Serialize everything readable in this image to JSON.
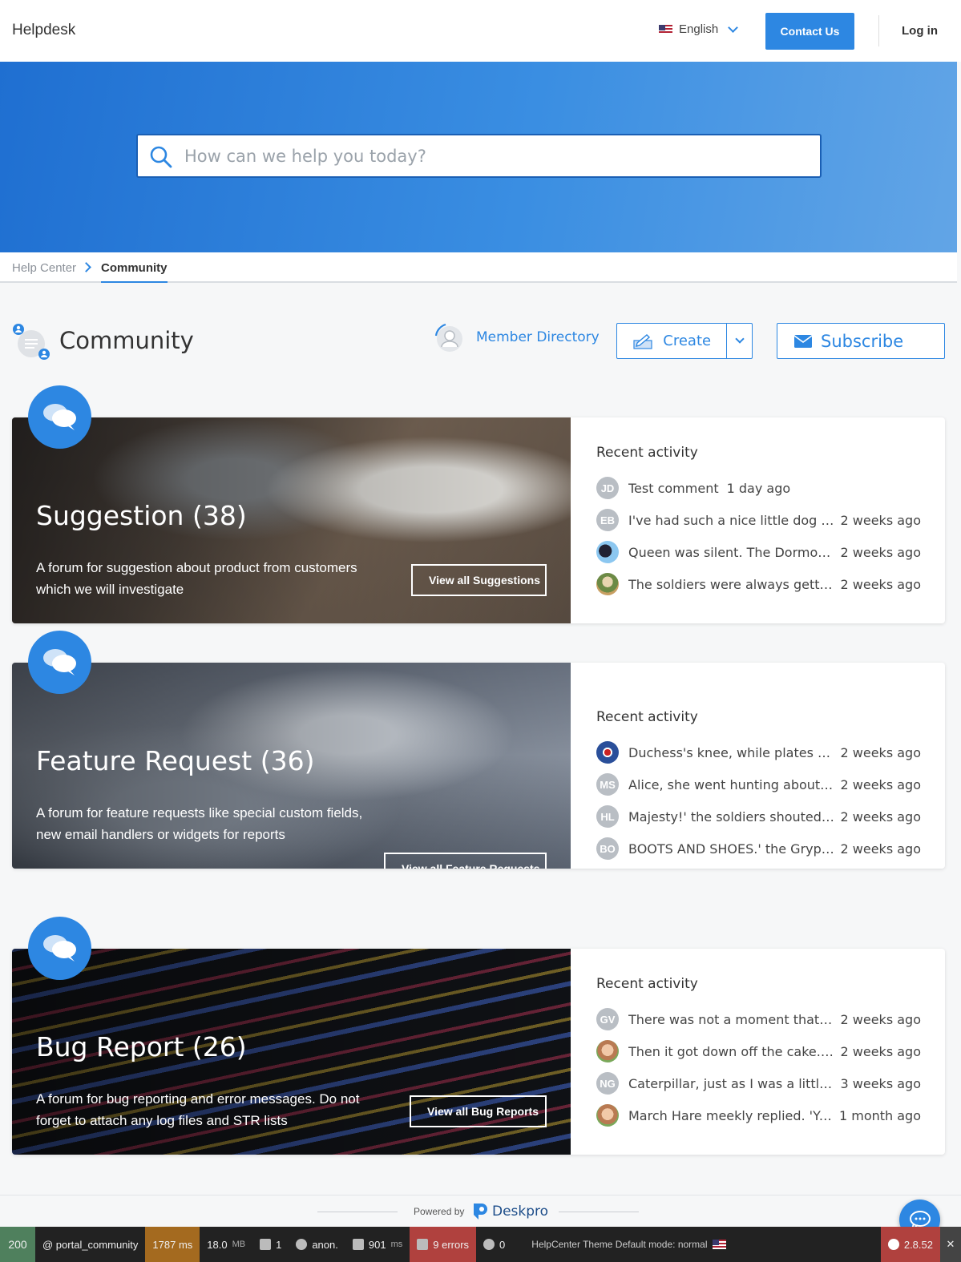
{
  "header": {
    "brand": "Helpdesk",
    "language": "English",
    "contact_label": "Contact Us",
    "login_label": "Log in"
  },
  "search": {
    "placeholder": "How can we help you today?",
    "value": ""
  },
  "breadcrumb": {
    "home": "Help Center",
    "current": "Community"
  },
  "page": {
    "title": "Community",
    "member_directory": "Member Directory",
    "create_label": "Create",
    "subscribe_label": "Subscribe"
  },
  "forums": [
    {
      "title": "Suggestion (38)",
      "description": "A forum for suggestion about product from customers which we will investigate",
      "view_label": "View all Suggestions",
      "activity_title": "Recent activity",
      "activity": [
        {
          "avatar": "JD",
          "text": "Test comment",
          "time": "1 day ago"
        },
        {
          "avatar": "EB",
          "text": "I've had such a nice little dog n…",
          "time": "2 weeks ago"
        },
        {
          "avatar": "",
          "text": "Queen was silent. The Dormous…",
          "time": "2 weeks ago"
        },
        {
          "avatar": "",
          "text": "The soldiers were always gettin…",
          "time": "2 weeks ago"
        }
      ]
    },
    {
      "title": "Feature Request (36)",
      "description": "A forum for feature requests like special custom fields, new email handlers or widgets for reports",
      "view_label": "View all Feature Requests",
      "activity_title": "Recent activity",
      "activity": [
        {
          "avatar": "",
          "text": "Duchess's knee, while plates an…",
          "time": "2 weeks ago"
        },
        {
          "avatar": "MS",
          "text": "Alice, she went hunting about, …",
          "time": "2 weeks ago"
        },
        {
          "avatar": "HL",
          "text": "Majesty!' the soldiers shouted i…",
          "time": "2 weeks ago"
        },
        {
          "avatar": "BO",
          "text": "BOOTS AND SHOES.' the Grypho…",
          "time": "2 weeks ago"
        }
      ]
    },
    {
      "title": "Bug Report (26)",
      "description": "A forum for bug reporting and error messages. Do not forget to attach any log files and STR lists",
      "view_label": "View all Bug Reports",
      "activity_title": "Recent activity",
      "activity": [
        {
          "avatar": "GV",
          "text": "There was not a moment that it …",
          "time": "2 weeks ago"
        },
        {
          "avatar": "",
          "text": "Then it got down off the cake. * …",
          "time": "2 weeks ago"
        },
        {
          "avatar": "NG",
          "text": "Caterpillar, just as I was a little …",
          "time": "3 weeks ago"
        },
        {
          "avatar": "",
          "text": "March Hare meekly replied. 'Yes…",
          "time": "1 month ago"
        }
      ]
    }
  ],
  "footer": {
    "powered_by": "Powered by",
    "brand": "Deskpro"
  },
  "debug_toolbar": {
    "status": "200",
    "route": "@ portal_community",
    "time": "1787 ms",
    "memory": "18.0",
    "memory_unit": "MB",
    "forms": "1",
    "user": "anon.",
    "db_time": "901",
    "db_unit": "ms",
    "errors": "9 errors",
    "events": "0",
    "theme": "HelpCenter Theme Default mode: normal",
    "version": "2.8.52"
  },
  "colors": {
    "accent": "#2d87e2",
    "hero_start": "#1f6fd1",
    "hero_end": "#62a5e6"
  }
}
